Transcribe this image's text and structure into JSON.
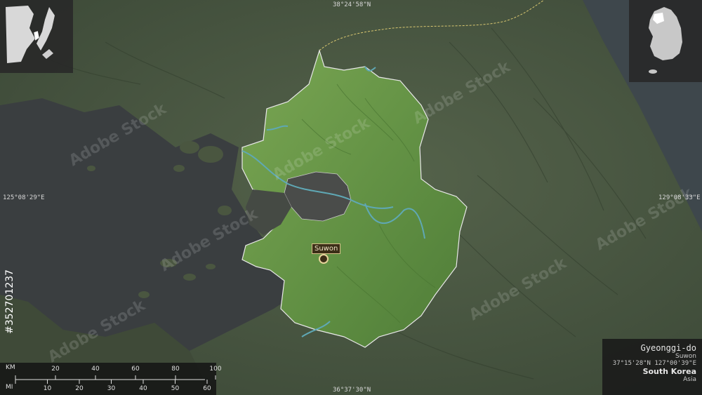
{
  "map": {
    "region_name": "Gyeonggi-do",
    "capital": "Suwon",
    "capital_coords": "37°15'28\"N 127°00'39\"E",
    "country": "South Korea",
    "continent": "Asia",
    "coords": {
      "top": "38°24'58\"N",
      "bottom": "36°37'30\"N",
      "left": "125°08'29\"E",
      "right": "129°08'33\"E"
    }
  },
  "scale": {
    "km_label": "KM",
    "mi_label": "MI",
    "km_ticks": [
      "20",
      "40",
      "60",
      "80",
      "100"
    ],
    "mi_ticks": [
      "10",
      "20",
      "30",
      "40",
      "50",
      "60"
    ]
  },
  "watermark": {
    "brand": "Adobe Stock",
    "id": "#352701237"
  },
  "colors": {
    "sea": "#3a3e40",
    "land": "#4c5a45",
    "region": "#6f9b4d",
    "border": "#e8e8e8"
  }
}
